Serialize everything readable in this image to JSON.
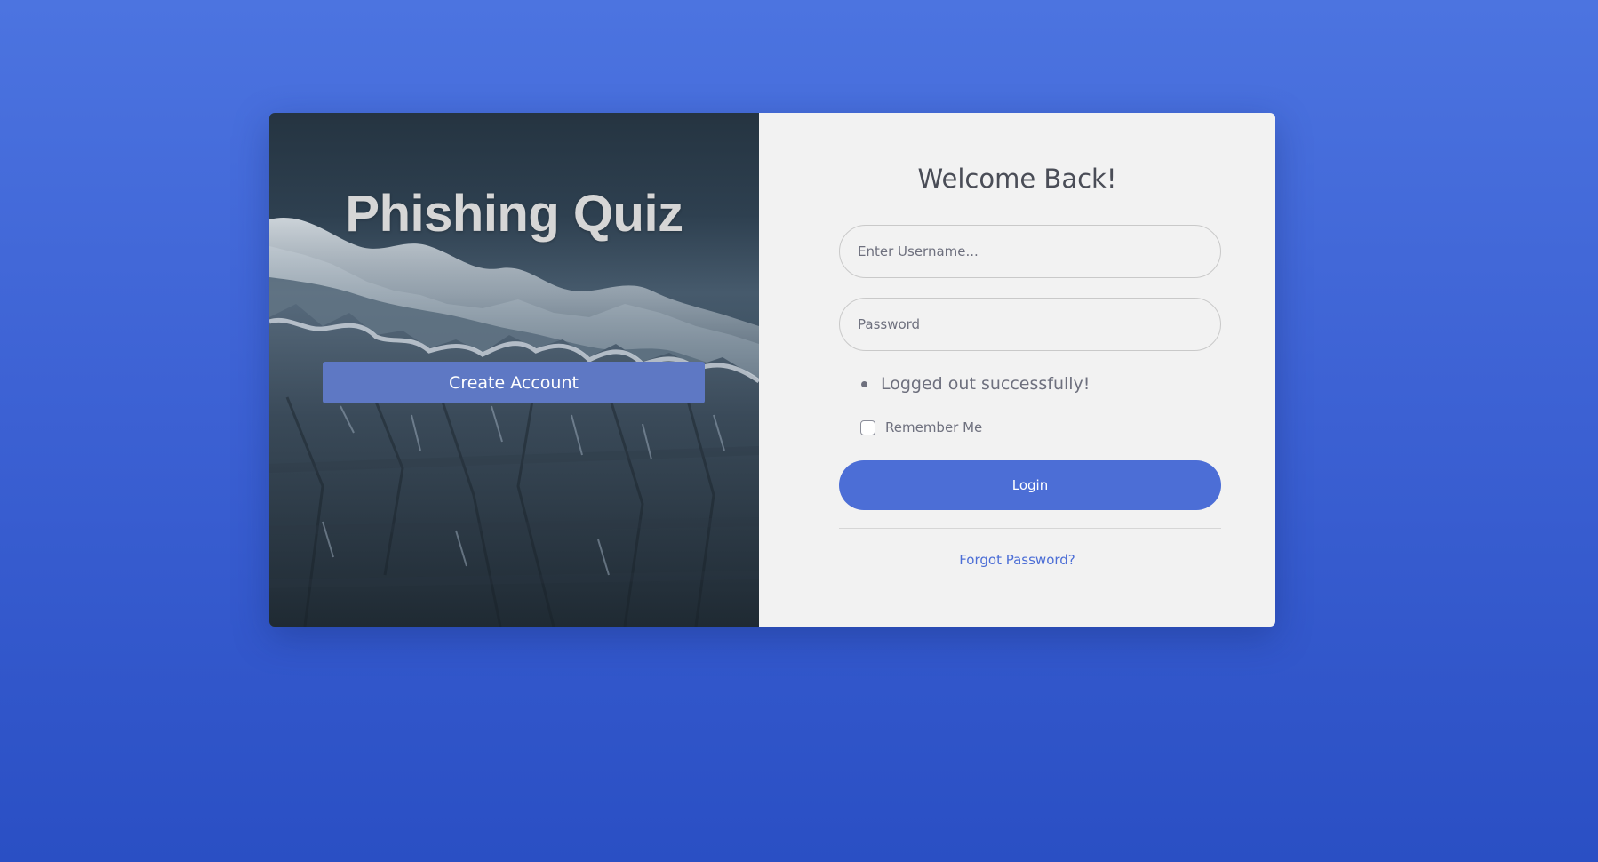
{
  "hero": {
    "title": "Phishing Quiz",
    "create_account_label": "Create Account"
  },
  "login": {
    "heading": "Welcome Back!",
    "username": {
      "value": "",
      "placeholder": "Enter Username..."
    },
    "password": {
      "value": "",
      "placeholder": "Password"
    },
    "messages": [
      "Logged out successfully!"
    ],
    "remember_me": {
      "label": "Remember Me",
      "checked": false
    },
    "login_label": "Login",
    "forgot_password_label": "Forgot Password?"
  },
  "colors": {
    "page_background": "#3d62d4",
    "primary_button": "#4c6ed6",
    "create_account_button": "#5e78c4",
    "form_panel": "#f2f2f2",
    "link": "#4c6ed6"
  }
}
